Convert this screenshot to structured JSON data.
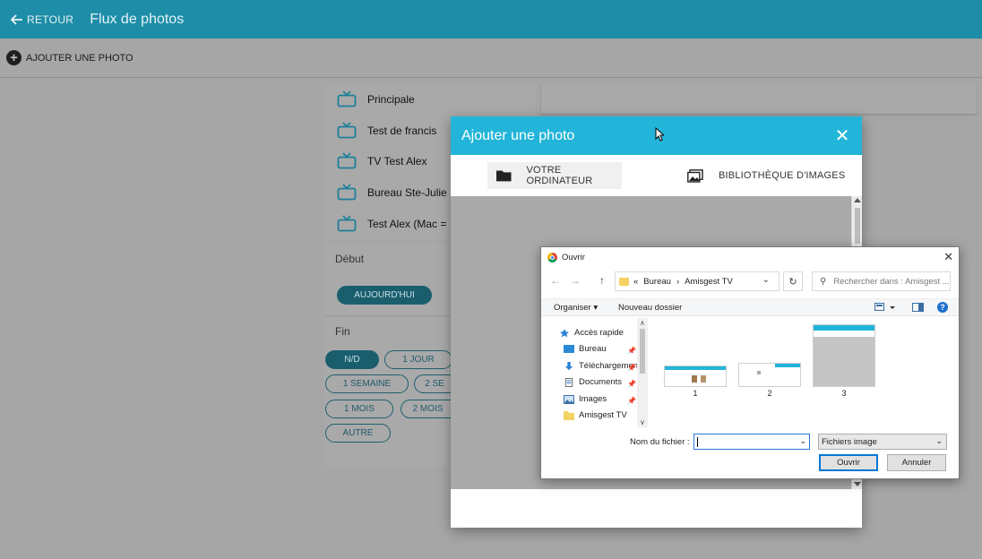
{
  "header": {
    "back_label": "RETOUR",
    "title": "Flux de photos"
  },
  "toolbar": {
    "add_photo_label": "AJOUTER UNE PHOTO"
  },
  "screens": [
    "Principale",
    "Test de francis",
    "TV Test Alex",
    "Bureau Ste-Julie",
    "Test Alex (Mac = "
  ],
  "schedule": {
    "start_label": "Début",
    "today_label": "AUJOURD'HUI",
    "end_label": "Fin",
    "options": [
      "N/D",
      "1 JOUR",
      "1 SEMAINE",
      "2 SE",
      "1 MOIS",
      "2 MOIS",
      "AUTRE"
    ]
  },
  "modal": {
    "title": "Ajouter une photo",
    "close_symbol": "✕",
    "tab_computer": "VOTRE ORDINATEUR",
    "tab_library": "BIBLIOTHÈQUE D'IMAGES"
  },
  "open_dialog": {
    "title": "Ouvrir",
    "close_symbol": "✕",
    "breadcrumb": [
      "«",
      "Bureau",
      "›",
      "Amisgest TV"
    ],
    "search_placeholder": "Rechercher dans : Amisgest ...",
    "organize_label": "Organiser ▾",
    "new_folder_label": "Nouveau dossier",
    "tree": [
      "Accès rapide",
      "Bureau",
      "Téléchargements",
      "Documents",
      "Images",
      "Amisgest TV"
    ],
    "files": [
      "1",
      "2",
      "3"
    ],
    "filename_label": "Nom du fichier :",
    "filename_value": "",
    "filetype_value": "Fichiers image",
    "open_button": "Ouvrir",
    "cancel_button": "Annuler"
  },
  "colors": {
    "header_bg": "#1e8ea8",
    "modal_header_bg": "#22b5d9",
    "pill_active": "#1a5e6e"
  }
}
